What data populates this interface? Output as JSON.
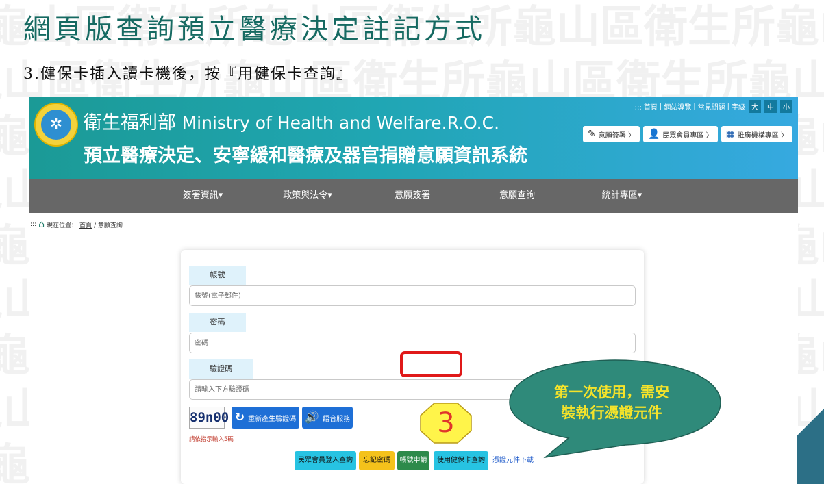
{
  "slide": {
    "title": "網頁版查詢預立醫療決定註記方式",
    "subtitle": "3.健保卡插入讀卡機後，按『用健保卡查詢』",
    "watermark": "龜山區衛生所"
  },
  "site": {
    "title_cn": "衛生福利部",
    "title_en": "Ministry of Health and Welfare.R.O.C.",
    "system_name": "預立醫療決定、安寧緩和醫療及器官捐贈意願資訊系統",
    "top_links": [
      "::: 首頁",
      "網站導覽",
      "常見問題",
      "字級"
    ],
    "font_sizes": [
      "大",
      "中",
      "小"
    ],
    "header_buttons": [
      {
        "label": "意願簽署 〉",
        "icon": "pen-icon",
        "color": "#222222"
      },
      {
        "label": "民眾會員專區 〉",
        "icon": "person-icon",
        "color": "#d9262c"
      },
      {
        "label": "推廣機構專區 〉",
        "icon": "org-icon",
        "color": "#1f5fae"
      }
    ]
  },
  "nav": [
    "簽署資訊▾",
    "政策與法令▾",
    "意願簽署",
    "意願查詢",
    "統計專區▾"
  ],
  "breadcrumb": {
    "marker": ":::",
    "prefix": "現在位置：",
    "home": "首頁",
    "current": "/ 意願查詢"
  },
  "form": {
    "account_label": "帳號",
    "account_placeholder": "帳號(電子郵件)",
    "password_label": "密碼",
    "password_placeholder": "密碼",
    "captcha_label": "驗證碼",
    "captcha_placeholder": "請輸入下方驗證碼",
    "captcha_code": "89n00",
    "regen_label": "重新產生驗證碼",
    "audio_label": "語音服務",
    "hint": "請依指示輸入5碼",
    "buttons": [
      {
        "label": "民眾會員登入查詢",
        "bg": "#27c3e2"
      },
      {
        "label": "忘記密碼",
        "bg": "#f4c21b"
      },
      {
        "label": "帳號申請",
        "bg": "#2d8a4a"
      },
      {
        "label": "使用健保卡查詢",
        "bg": "#27c3e2"
      }
    ],
    "download_link": "憑證元件下載"
  },
  "callouts": {
    "step_number": "3",
    "bubble_line1": "第一次使用，需安",
    "bubble_line2": "裝執行憑證元件"
  },
  "colors": {
    "title_teal": "#166a62",
    "nav_gray": "#676767",
    "highlight_red": "#e01919",
    "bubble_green": "#2f8a7a",
    "octagon_yellow": "#fff44a"
  }
}
